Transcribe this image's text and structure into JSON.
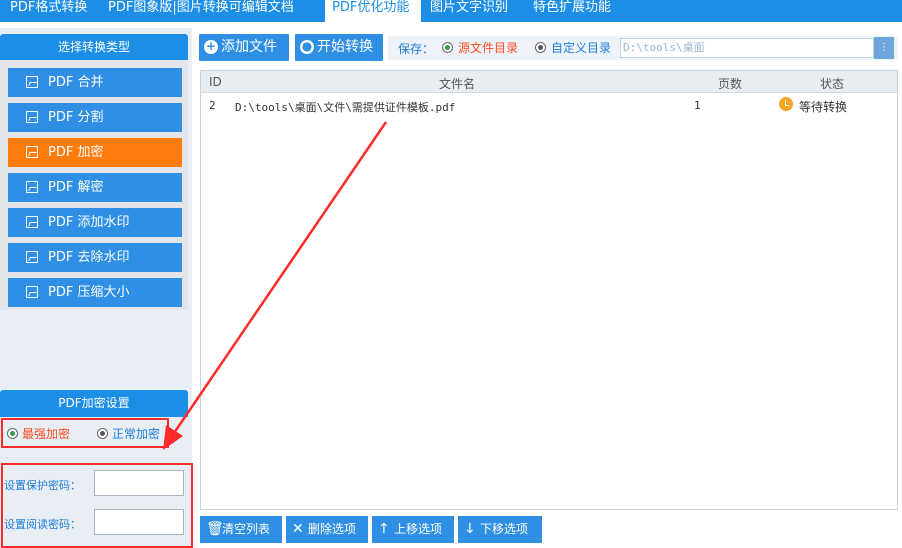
{
  "top_tabs": [
    {
      "label": "PDF格式转换"
    },
    {
      "label": "PDF图象版|图片转换可编辑文档"
    },
    {
      "label": "PDF优化功能",
      "active": true
    },
    {
      "label": "图片文字识别"
    },
    {
      "label": "特色扩展功能"
    }
  ],
  "sidebar": {
    "title": "选择转换类型",
    "items": [
      {
        "label": "PDF 合并"
      },
      {
        "label": "PDF 分割"
      },
      {
        "label": "PDF 加密",
        "active": true
      },
      {
        "label": "PDF 解密"
      },
      {
        "label": "PDF 添加水印"
      },
      {
        "label": "PDF 去除水印"
      },
      {
        "label": "PDF 压缩大小"
      }
    ]
  },
  "settings": {
    "title": "PDF加密设置",
    "opt_strong": "最强加密",
    "opt_normal": "正常加密",
    "protect_label": "设置保护密码：",
    "read_label": "设置阅读密码：",
    "protect_value": "",
    "read_value": ""
  },
  "toolbar": {
    "add_file": "添加文件",
    "start": "开始转换",
    "save_label": "保存：",
    "source_dir": "源文件目录",
    "custom_dir": "自定义目录",
    "path": "D:\\tools\\桌面"
  },
  "table": {
    "headers": {
      "id": "ID",
      "name": "文件名",
      "pages": "页数",
      "status": "状态"
    },
    "rows": [
      {
        "id": "2",
        "name": "D:\\tools\\桌面\\文件\\需提供证件模板.pdf",
        "pages": "1",
        "status": "等待转换"
      }
    ]
  },
  "bottom": {
    "clear": "清空列表",
    "delete": "删除选项",
    "up": "上移选项",
    "down": "下移选项"
  },
  "colors": {
    "accent": "#1d8ee6",
    "active": "#ff7b0e",
    "annotation": "#ff2a2a"
  }
}
